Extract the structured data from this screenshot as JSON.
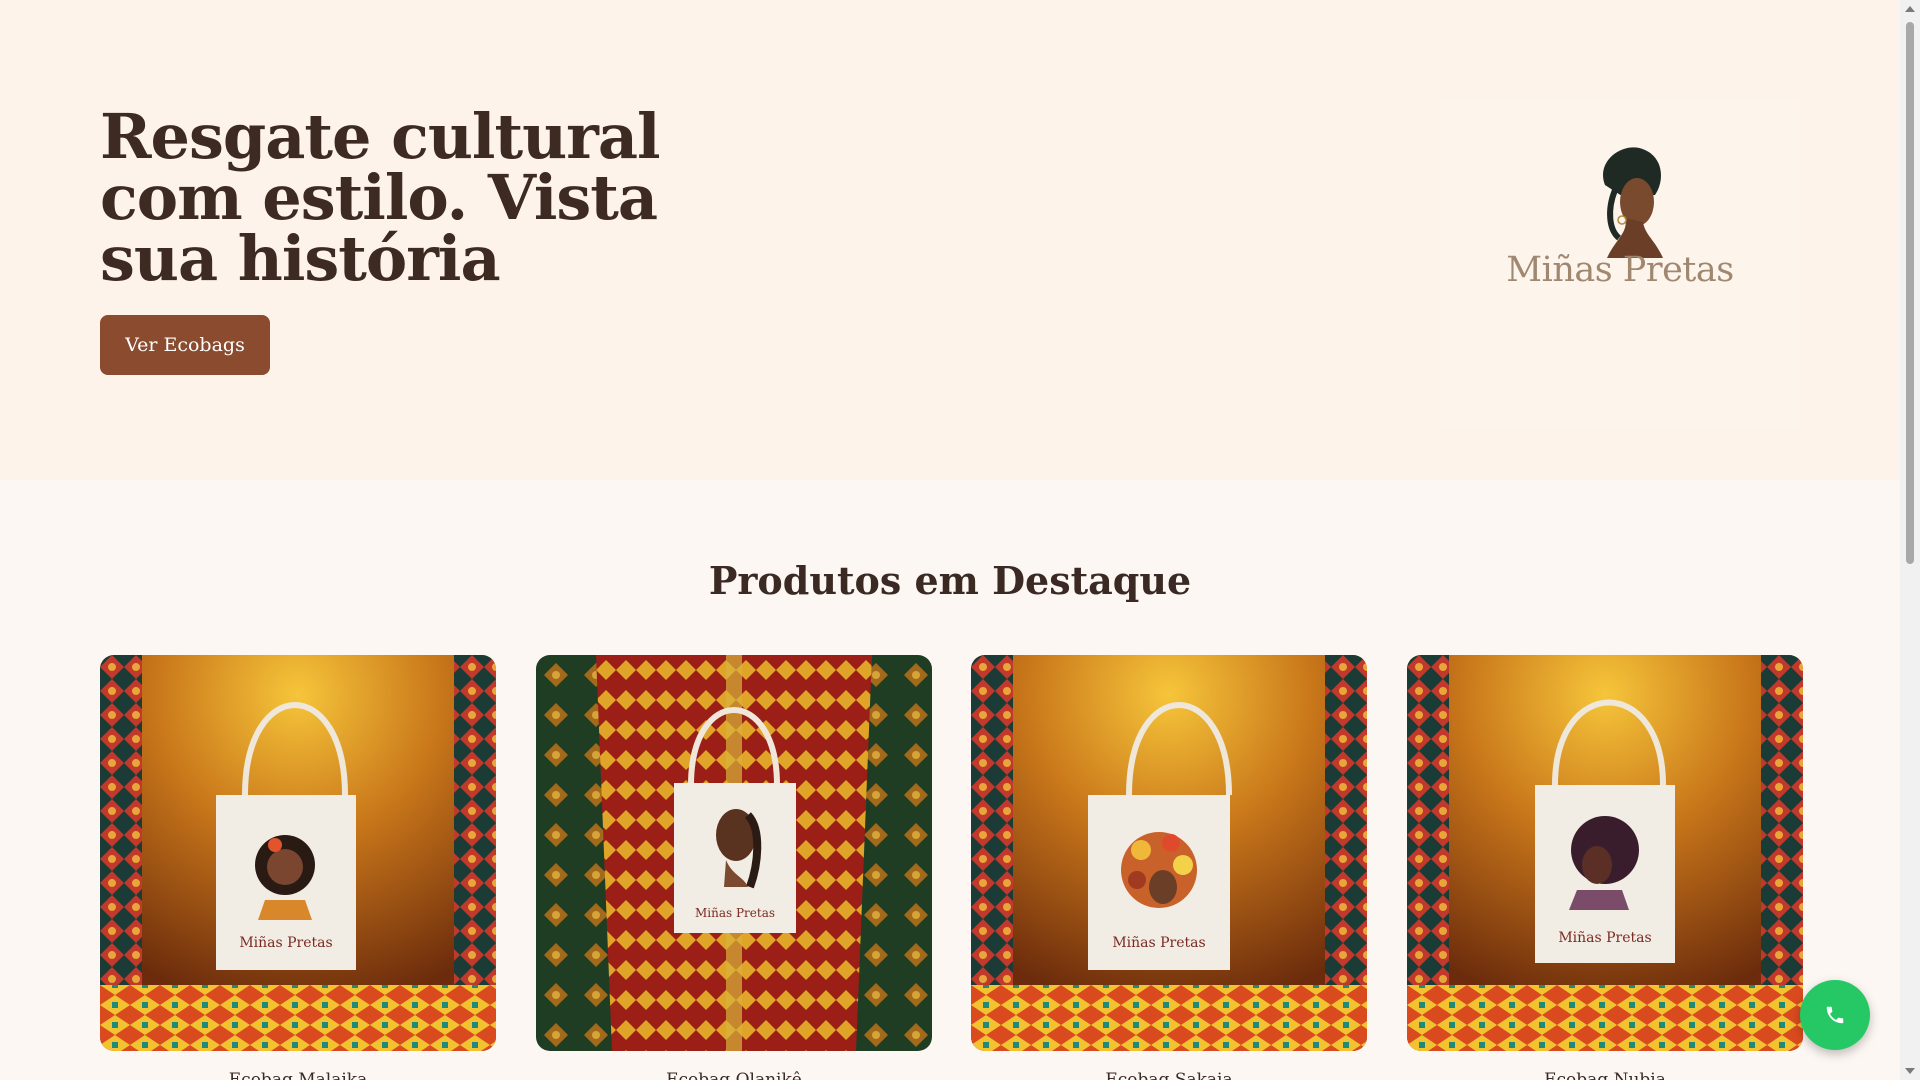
{
  "hero": {
    "title": "Resgate cultural com estilo. Vista sua história",
    "cta_label": "Ver Ecobags"
  },
  "logo": {
    "text": "Miñas Pretas"
  },
  "featured": {
    "title": "Produtos em Destaque",
    "bag_brand": "Miñas Pretas",
    "products": [
      {
        "name": "Ecobag Malaika"
      },
      {
        "name": "Ecobag Olanikê"
      },
      {
        "name": "Ecobag Sakaia"
      },
      {
        "name": "Ecobag Nubia"
      }
    ]
  },
  "colors": {
    "hero_bg": "#fdf3ea",
    "page_bg": "#fdf7f3",
    "button": "#8a4b2f",
    "heading": "#3d2a22",
    "whatsapp": "#25c864"
  },
  "icons": {
    "floating": "phone-icon"
  }
}
